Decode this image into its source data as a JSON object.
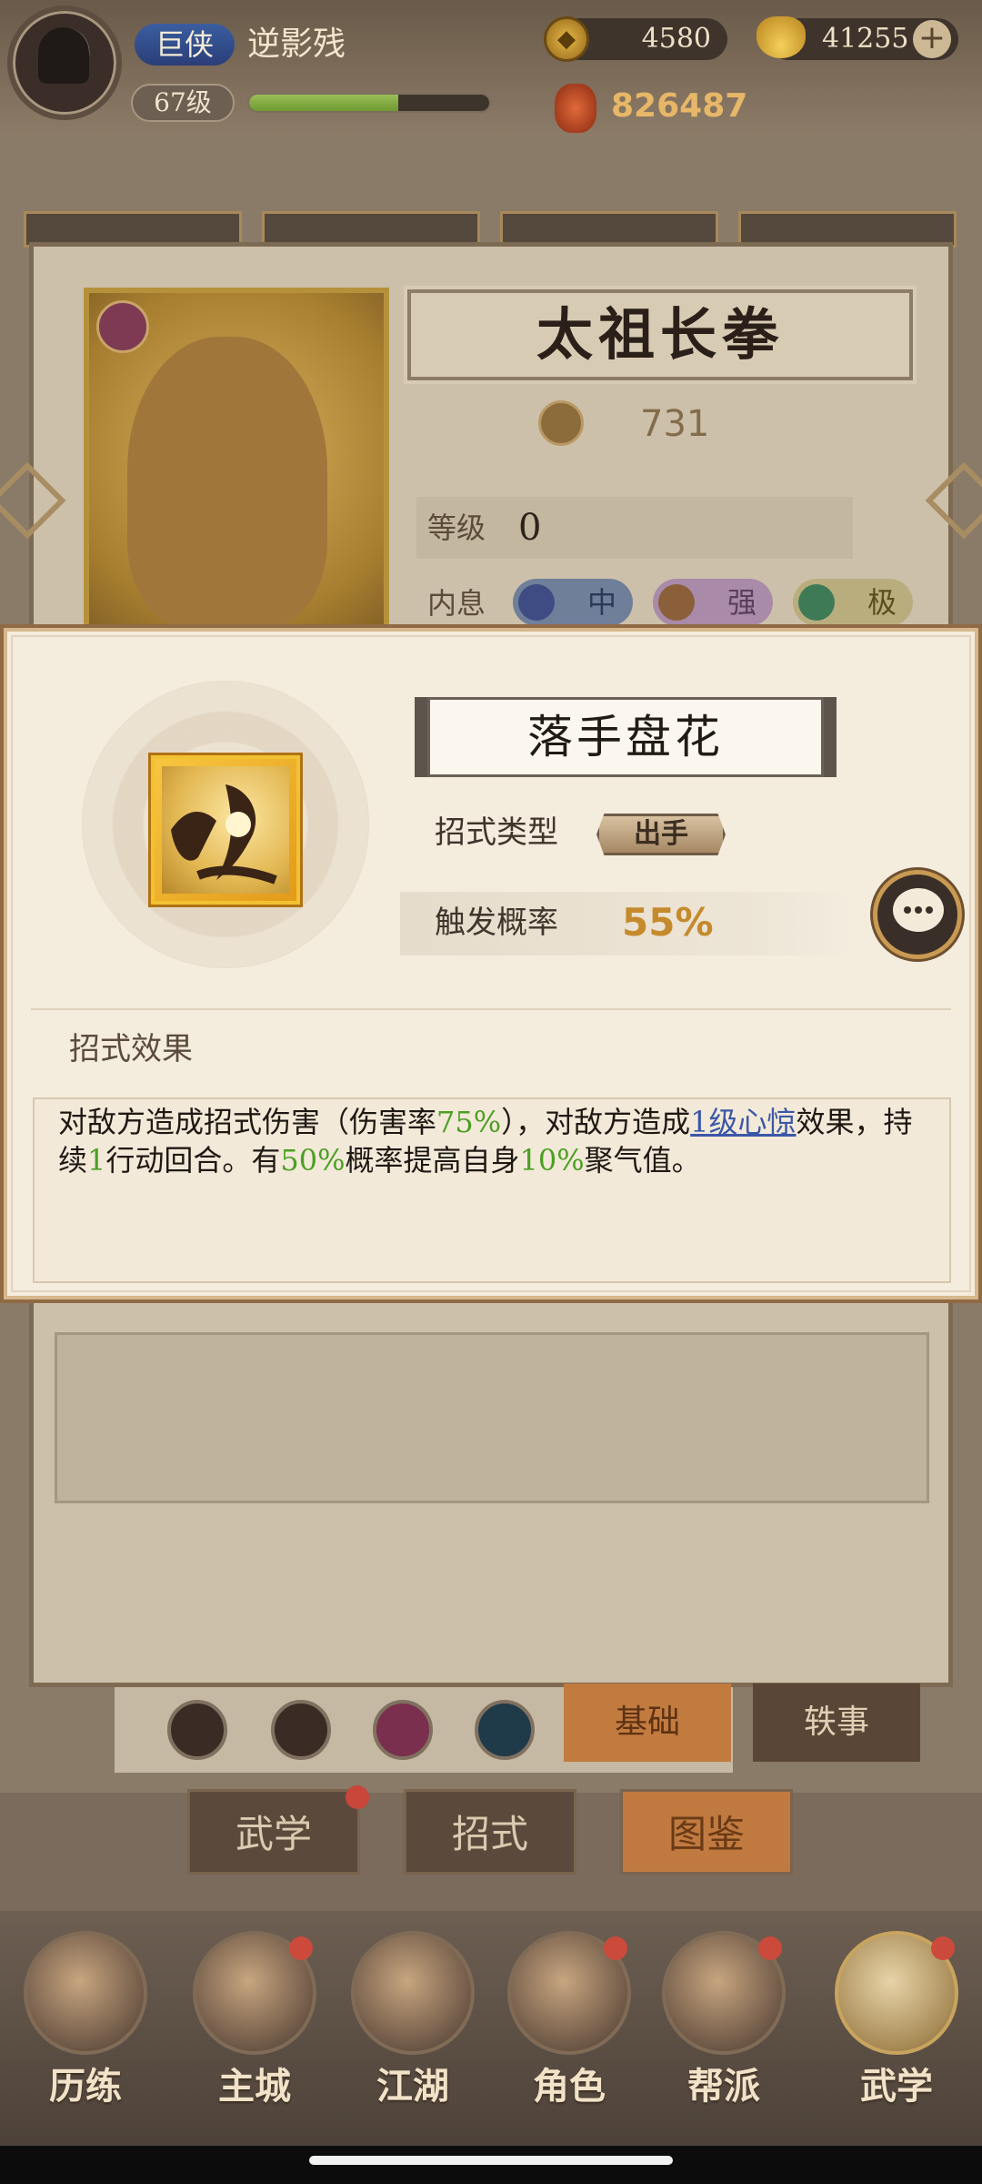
{
  "player": {
    "rank": "巨侠",
    "name": "逆影残",
    "level": "67级",
    "exp_fraction": 0.62,
    "power": "826487"
  },
  "currency": {
    "coins": "4580",
    "ingots": "41255",
    "add_symbol": "+"
  },
  "background_card": {
    "title": "太祖长拳",
    "power": "731",
    "level_label": "等级",
    "level_value": "0",
    "neixi_label": "内息",
    "neixi": [
      "中",
      "强",
      "极"
    ],
    "tabs": [
      "基础",
      "轶事"
    ]
  },
  "sub_tabs": [
    "武学",
    "招式",
    "图鉴"
  ],
  "bottom_nav": [
    {
      "label": "历练",
      "icon": "training-icon",
      "badge": false
    },
    {
      "label": "主城",
      "icon": "city-icon",
      "badge": true
    },
    {
      "label": "江湖",
      "icon": "jianghu-icon",
      "badge": false
    },
    {
      "label": "角色",
      "icon": "character-icon",
      "badge": true
    },
    {
      "label": "帮派",
      "icon": "guild-icon",
      "badge": true
    },
    {
      "label": "武学",
      "icon": "scroll-icon",
      "badge": true
    }
  ],
  "modal": {
    "skill_name": "落手盘花",
    "type_label": "招式类型",
    "type_value": "出手",
    "trigger_label": "触发概率",
    "trigger_value": "55%",
    "effect_title": "招式效果",
    "effect": {
      "p1": "对敌方造成招式伤害（伤害率",
      "v1": "75%",
      "p2": "），对敌方造成",
      "link": "1级心惊",
      "p3": "效果，持续",
      "v2": "1",
      "p4": "行动回合。有",
      "v3": "50%",
      "p5": "概率提高自身",
      "v4": "10%",
      "p6": "聚气值。"
    }
  },
  "colors": {
    "accent_gold": "#c58a2c",
    "highlight_green": "#4c9f24",
    "link_blue": "#3b57a8"
  }
}
